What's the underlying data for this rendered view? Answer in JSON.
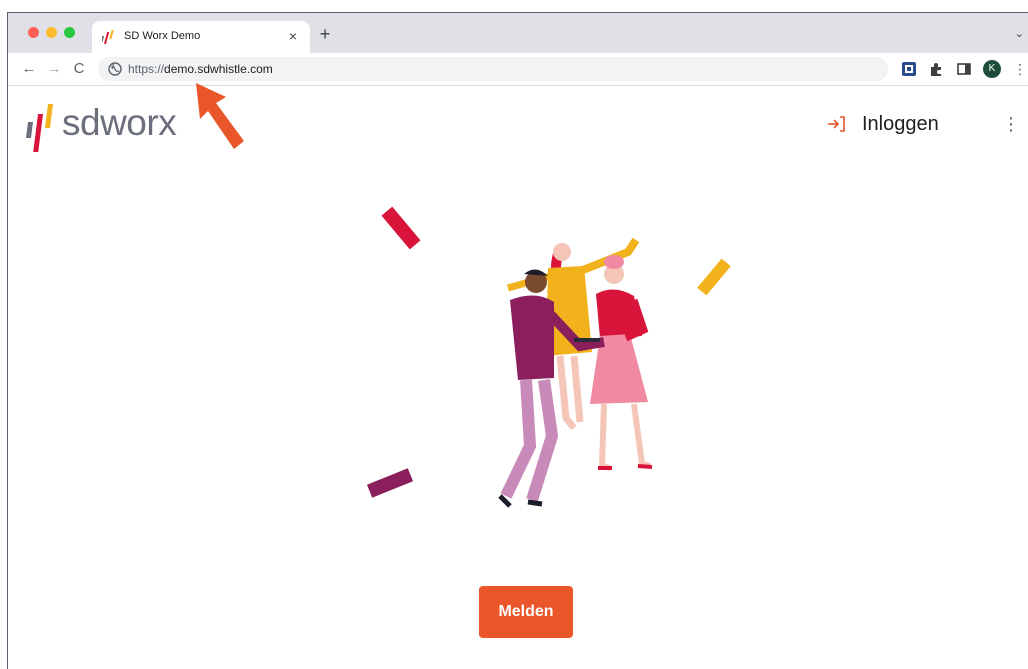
{
  "browser": {
    "tab": {
      "title": "SD Worx Demo",
      "close_glyph": "×"
    },
    "new_tab_glyph": "+",
    "tab_menu_glyph": "⌄",
    "toolbar": {
      "back_glyph": "←",
      "forward_glyph": "→",
      "reload_glyph": "C",
      "url_scheme": "https://",
      "url_host": "demo.sdwhistle.com",
      "profile_initial": "K",
      "menu_glyph": "⋮"
    }
  },
  "header": {
    "logo_text": "sdworx",
    "login_label": "Inloggen",
    "menu_glyph": "⋮"
  },
  "main": {
    "report_button": "Melden"
  },
  "colors": {
    "accent_orange": "#e8562a",
    "brand_red": "#d9143a",
    "brand_purple": "#8a1f5c",
    "brand_yellow": "#f2b21c",
    "brand_grey": "#6b6f7d"
  },
  "icons": {
    "favicon": "sdworx-logo-icon",
    "site_info": "globe-icon",
    "login": "login-arrow-icon"
  }
}
